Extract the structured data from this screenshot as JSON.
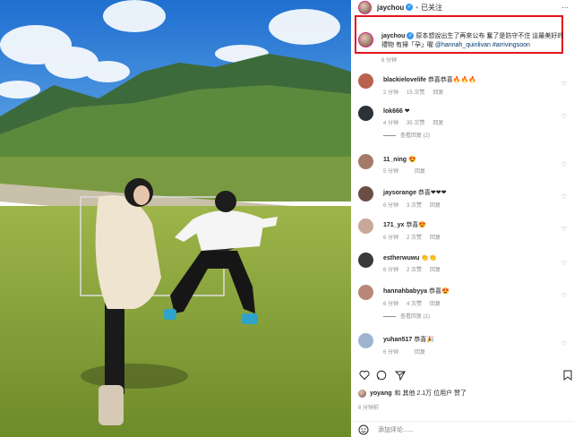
{
  "post": {
    "username": "jaychou",
    "follow_status": "已关注",
    "caption_user": "jaychou",
    "caption_text": "原本想說出生了再來公布 奮了是防守不住 這最美好的禮物 有掃「孕」喔",
    "caption_mention": "@hannah_quinlivan",
    "caption_hashtag": "#arrivingsoon",
    "caption_time": "6 分钟"
  },
  "comments": [
    {
      "user": "blackielovelife",
      "text": "恭喜恭喜🔥🔥🔥",
      "time": "2 分钟",
      "likes": "15 次赞",
      "reply": "回复",
      "replies": ""
    },
    {
      "user": "lok666",
      "text": "❤",
      "time": "4 分钟",
      "likes": "35 次赞",
      "reply": "回复",
      "replies": "查看回复 (2)"
    },
    {
      "user": "11_ning",
      "text": "😍",
      "time": "5 分钟",
      "likes": "",
      "reply": "回复",
      "replies": ""
    },
    {
      "user": "jaysorange",
      "text": "恭喜❤❤❤",
      "time": "6 分钟",
      "likes": "3 次赞",
      "reply": "回复",
      "replies": ""
    },
    {
      "user": "171_yx",
      "text": "恭喜😍",
      "time": "6 分钟",
      "likes": "2 次赞",
      "reply": "回复",
      "replies": ""
    },
    {
      "user": "estherwuwu",
      "text": "👏👏",
      "time": "6 分钟",
      "likes": "2 次赞",
      "reply": "回复",
      "replies": ""
    },
    {
      "user": "hannahbabyya",
      "text": "恭喜😍",
      "time": "6 分钟",
      "likes": "4 次赞",
      "reply": "回复",
      "replies": "查看回复 (1)"
    },
    {
      "user": "yuhan517",
      "text": "恭喜🎉",
      "time": "6 分钟",
      "likes": "",
      "reply": "回复",
      "replies": ""
    }
  ],
  "likes": {
    "user": "yoyang",
    "text": "和 其他 2.1万 位用户 赞了"
  },
  "timestamp": "6 分钟前",
  "add_comment": {
    "placeholder": "添加评论......"
  },
  "colors": {
    "highlight": "#e4141b",
    "verified": "#3897f0"
  },
  "icons": [
    "heart-icon",
    "comment-icon",
    "share-icon",
    "bookmark-icon",
    "emoji-icon"
  ]
}
